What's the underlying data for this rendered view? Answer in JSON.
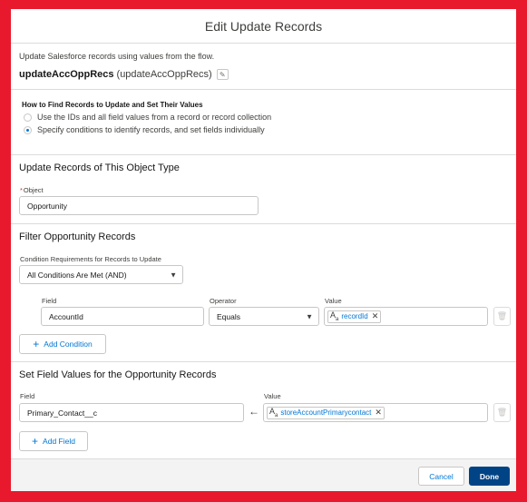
{
  "modal": {
    "title": "Edit Update Records"
  },
  "intro": {
    "description": "Update Salesforce records using values from the flow.",
    "label": "updateAccOppRecs",
    "api_name": "(updateAccOppRecs)"
  },
  "how": {
    "title": "How to Find Records to Update and Set Their Values",
    "options": [
      {
        "label": "Use the IDs and all field values from a record or record collection",
        "selected": false
      },
      {
        "label": "Specify conditions to identify records, and set fields individually",
        "selected": true
      }
    ]
  },
  "object_section": {
    "title": "Update Records of This Object Type",
    "required_mark": "*",
    "object_label": "Object",
    "object_value": "Opportunity"
  },
  "filter_section": {
    "title": "Filter Opportunity Records",
    "condition_label": "Condition Requirements for Records to Update",
    "condition_value": "All Conditions Are Met (AND)",
    "columns": {
      "field": "Field",
      "operator": "Operator",
      "value": "Value"
    },
    "row": {
      "field": "AccountId",
      "operator": "Equals",
      "value_icon": "A",
      "value_icon_sub": "a",
      "value": "recordId"
    },
    "add_condition": "Add Condition"
  },
  "set_section": {
    "title": "Set Field Values for the Opportunity Records",
    "columns": {
      "field": "Field",
      "value": "Value"
    },
    "row": {
      "field": "Primary_Contact__c",
      "value_icon": "A",
      "value_icon_sub": "a",
      "value": "storeAccountPrimarycontact"
    },
    "add_field": "Add Field"
  },
  "footer": {
    "cancel": "Cancel",
    "done": "Done"
  },
  "colors": {
    "frame": "#e8192c",
    "brand": "#014486",
    "link": "#0176d3"
  }
}
